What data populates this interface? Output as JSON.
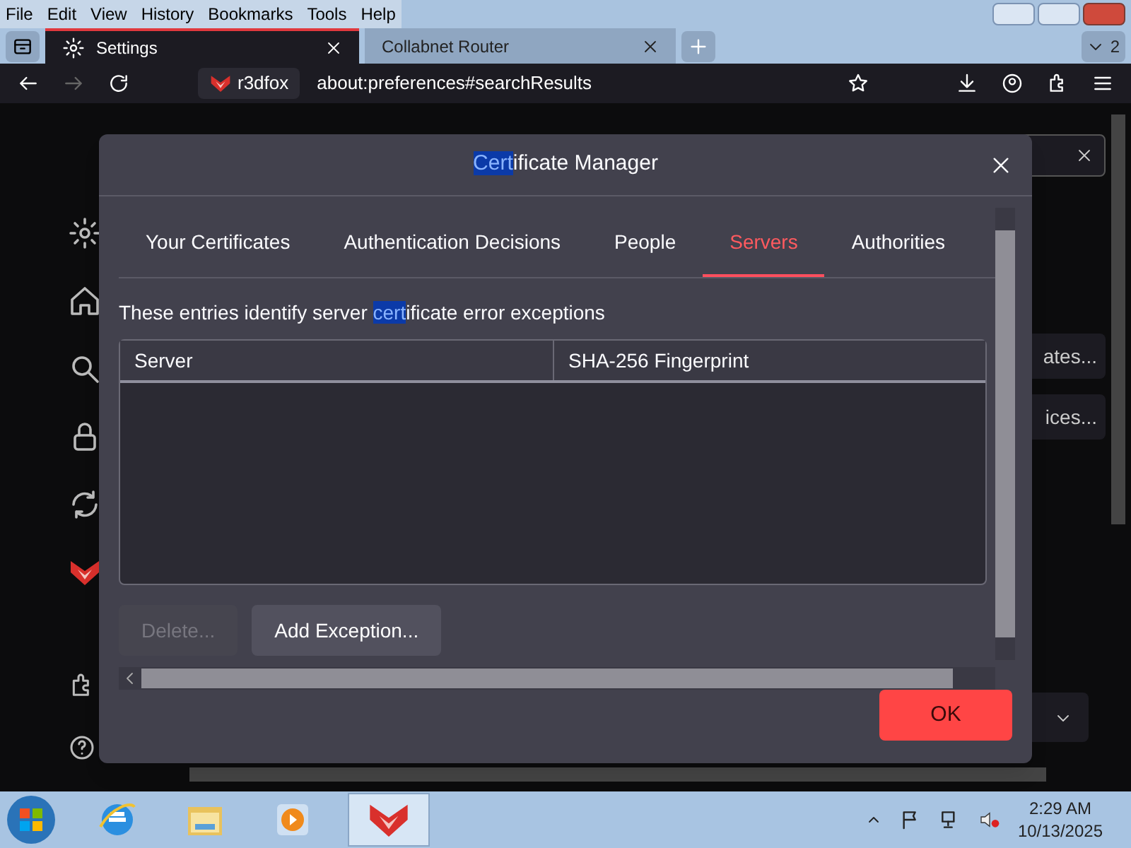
{
  "menu_bar": [
    "File",
    "Edit",
    "View",
    "History",
    "Bookmarks",
    "Tools",
    "Help"
  ],
  "tabs": [
    {
      "label": "Settings",
      "selected": true
    },
    {
      "label": "Collabnet Router",
      "selected": false
    }
  ],
  "tab_count": "2",
  "nav": {
    "identity": "r3dfox",
    "url": "about:preferences#searchResults"
  },
  "background_buttons": [
    "ates...",
    "ices..."
  ],
  "dialog": {
    "title_parts": [
      {
        "text": "Cert",
        "highlighted": true
      },
      {
        "text": "ificate Manager",
        "highlighted": false
      }
    ],
    "tabs": [
      {
        "label": "Your Certificates",
        "selected": false
      },
      {
        "label": "Authentication Decisions",
        "selected": false
      },
      {
        "label": "People",
        "selected": false
      },
      {
        "label": "Servers",
        "selected": true
      },
      {
        "label": "Authorities",
        "selected": false
      }
    ],
    "description_parts": [
      {
        "text": "These entries identify server ",
        "highlighted": false
      },
      {
        "text": "cert",
        "highlighted": true
      },
      {
        "text": "ificate error exceptions",
        "highlighted": false
      }
    ],
    "columns": [
      "Server",
      "SHA-256 Fingerprint"
    ],
    "buttons": [
      {
        "label": "Delete...",
        "disabled": true
      },
      {
        "label": "Add Exception...",
        "disabled": false
      }
    ],
    "ok": "OK"
  },
  "clock": {
    "time": "2:29 AM",
    "date": "10/13/2025"
  }
}
